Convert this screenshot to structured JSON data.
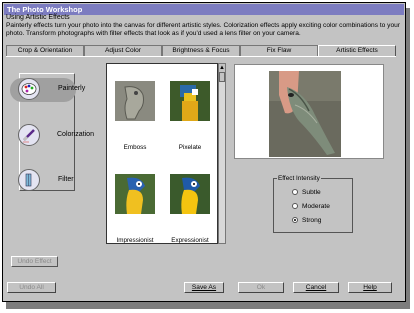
{
  "window": {
    "title": "The Photo Workshop"
  },
  "header": {
    "title": "Using Artistic Effects",
    "description": "Painterly effects turn your photo into the canvas for different artistic styles. Colorization effects apply exciting color combinations to your photo. Transform photographs with filter effects that look as if you'd used a lens filter on your camera."
  },
  "tabs": [
    {
      "label": "Crop & Orientation"
    },
    {
      "label": "Adjust Color"
    },
    {
      "label": "Brightness & Focus"
    },
    {
      "label": "Fix Flaw"
    },
    {
      "label": "Artistic Effects",
      "active": true
    }
  ],
  "categories": [
    {
      "label": "Painterly",
      "icon": "palette-icon",
      "selected": true
    },
    {
      "label": "Colorization",
      "icon": "paintbrush-icon"
    },
    {
      "label": "Filter",
      "icon": "lens-filter-icon"
    }
  ],
  "undo_effect_label": "Undo Effect",
  "thumbnails": [
    {
      "label": "Emboss"
    },
    {
      "label": "Pixelate"
    },
    {
      "label": "Impressionist"
    },
    {
      "label": "Expressionist"
    }
  ],
  "effect_intensity": {
    "legend": "Effect Intensity",
    "options": [
      {
        "label": "Subtle",
        "checked": false
      },
      {
        "label": "Moderate",
        "checked": false
      },
      {
        "label": "Strong",
        "checked": true
      }
    ]
  },
  "buttons": {
    "undo_all": "Undo All",
    "save_as": "Save As",
    "ok": "Ok",
    "cancel": "Cancel",
    "help": "Help"
  },
  "colors": {
    "title_bar": "#7c7cc0",
    "window_bg": "#c3c3c3"
  }
}
